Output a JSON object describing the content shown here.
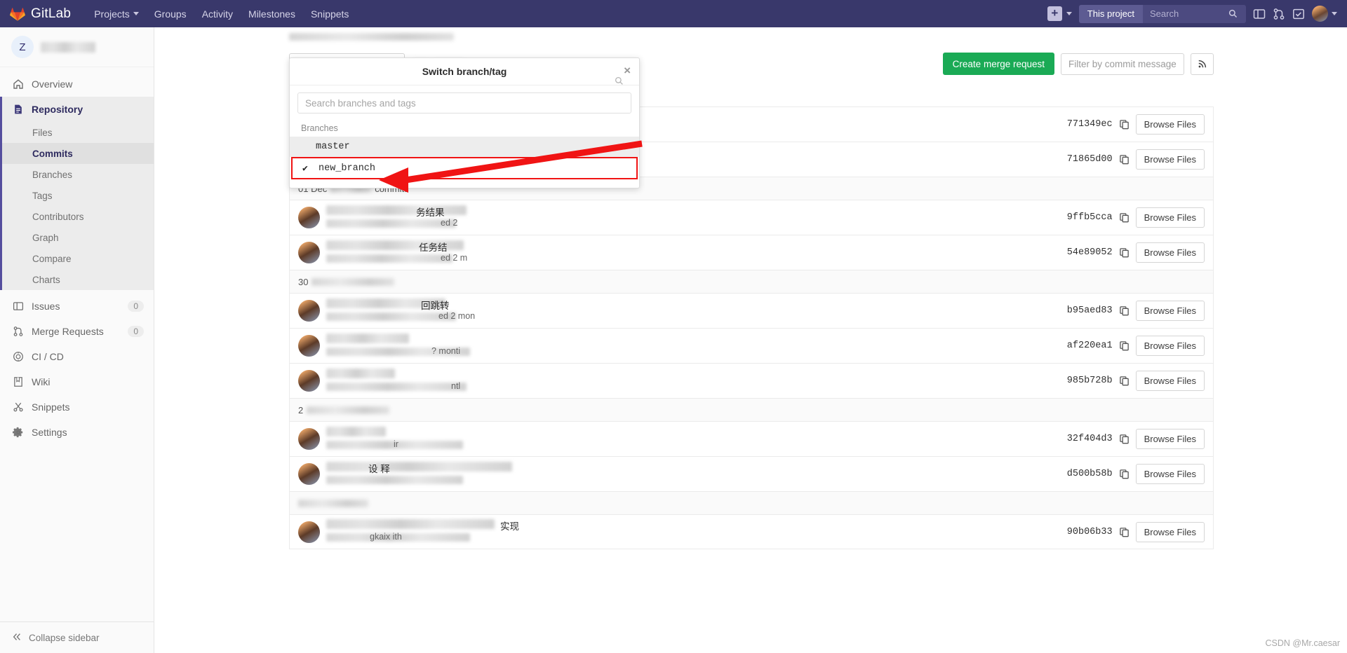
{
  "topnav": {
    "brand": "GitLab",
    "items": [
      {
        "label": "Projects",
        "has_caret": true
      },
      {
        "label": "Groups",
        "has_caret": false
      },
      {
        "label": "Activity",
        "has_caret": false
      },
      {
        "label": "Milestones",
        "has_caret": false
      },
      {
        "label": "Snippets",
        "has_caret": false
      }
    ],
    "plus_icon": "plus-icon",
    "search_scope": "This project",
    "search_placeholder": "Search",
    "search_value": "",
    "icons": [
      "issues-board-icon",
      "merge-request-icon",
      "todos-icon"
    ],
    "avatar": "user-avatar"
  },
  "sidebar": {
    "project_initial": "Z",
    "overview": {
      "label": "Overview",
      "icon": "home-icon"
    },
    "repository": {
      "label": "Repository",
      "icon": "document-icon"
    },
    "repository_children": [
      {
        "label": "Files",
        "active": false
      },
      {
        "label": "Commits",
        "active": true
      },
      {
        "label": "Branches",
        "active": false
      },
      {
        "label": "Tags",
        "active": false
      },
      {
        "label": "Contributors",
        "active": false
      },
      {
        "label": "Graph",
        "active": false
      },
      {
        "label": "Compare",
        "active": false
      },
      {
        "label": "Charts",
        "active": false
      }
    ],
    "items": [
      {
        "label": "Issues",
        "icon": "issues-icon",
        "count": "0"
      },
      {
        "label": "Merge Requests",
        "icon": "merge-request-icon",
        "count": "0"
      },
      {
        "label": "CI / CD",
        "icon": "rocket-icon",
        "count": ""
      },
      {
        "label": "Wiki",
        "icon": "book-icon",
        "count": ""
      },
      {
        "label": "Snippets",
        "icon": "scissors-icon",
        "count": ""
      },
      {
        "label": "Settings",
        "icon": "gear-icon",
        "count": ""
      }
    ],
    "collapse": {
      "label": "Collapse sidebar",
      "icon": "chevron-double-left-icon"
    }
  },
  "toolbar": {
    "branch_value": "new_branch",
    "create_mr_label": "Create merge request",
    "filter_placeholder": "Filter by commit message",
    "filter_value": "",
    "rss_icon": "rss-icon"
  },
  "branch_dropdown": {
    "title": "Switch branch/tag",
    "close_icon": "close-icon",
    "search_placeholder": "Search branches and tags",
    "search_value": "",
    "group_label": "Branches",
    "options": [
      {
        "name": "master",
        "selected": false,
        "highlighted": true,
        "boxed": false
      },
      {
        "name": "new_branch",
        "selected": true,
        "highlighted": false,
        "boxed": true
      }
    ]
  },
  "commits": {
    "day_headers": [
      {
        "id": "d1",
        "text": "01 Dec",
        "suffix": "commits",
        "count_redacted": true
      },
      {
        "id": "d2",
        "text": "30",
        "suffix": "",
        "count_redacted": true
      },
      {
        "id": "d3",
        "text": "2",
        "suffix": "",
        "count_redacted": true
      }
    ],
    "rows": [
      {
        "sha": "771349ec",
        "browse_label": "Browse Files",
        "visible_title": "",
        "visible_sub": "",
        "redacted": true
      },
      {
        "sha": "71865d00",
        "browse_label": "Browse Files",
        "visible_title": "",
        "visible_sub": "",
        "redacted": true
      },
      {
        "sha": "9ffb5cca",
        "browse_label": "Browse Files",
        "visible_title": "务结果",
        "visible_sub": "ed 2",
        "redacted": true
      },
      {
        "sha": "54e89052",
        "browse_label": "Browse Files",
        "visible_title": "任务结",
        "visible_sub": "ed 2 m",
        "redacted": true
      },
      {
        "sha": "b95aed83",
        "browse_label": "Browse Files",
        "visible_title": "回跳转",
        "visible_sub": "ed 2 mon",
        "redacted": true
      },
      {
        "sha": "af220ea1",
        "browse_label": "Browse Files",
        "visible_title": "",
        "visible_sub": "? monti",
        "redacted": true
      },
      {
        "sha": "985b728b",
        "browse_label": "Browse Files",
        "visible_title": "",
        "visible_sub": "ntl",
        "redacted": true
      },
      {
        "sha": "32f404d3",
        "browse_label": "Browse Files",
        "visible_title": "",
        "visible_sub": "ir",
        "redacted": true
      },
      {
        "sha": "d500b58b",
        "browse_label": "Browse Files",
        "visible_title": "设 释",
        "visible_sub": "",
        "redacted": true
      },
      {
        "sha": "90b06b33",
        "browse_label": "Browse Files",
        "visible_title": "实现",
        "visible_sub": "gkaix ith",
        "redacted": true
      }
    ],
    "copy_icon": "copy-icon"
  },
  "annotation": {
    "arrow_color": "#f01414",
    "highlight_color": "#f01414",
    "target": "new_branch"
  },
  "watermark": "CSDN @Mr.caesar"
}
